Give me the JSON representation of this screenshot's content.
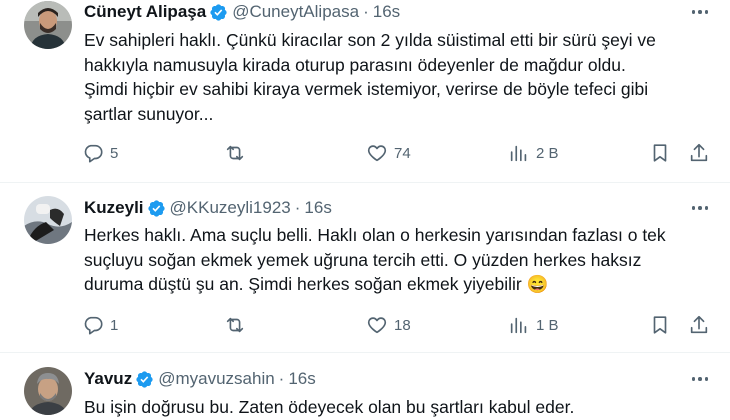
{
  "tweets": [
    {
      "name": "Cüneyt Alipaşa",
      "handle": "@CuneytAlipasa",
      "separator": "·",
      "time": "16s",
      "lines": [
        "Ev sahipleri haklı. Çünkü kiracılar son 2 yılda süistimal etti bir sürü şeyi ve",
        "hakkıyla namusuyla kirada oturup parasını ödeyenler de mağdur oldu.",
        "Şimdi hiçbir ev sahibi kiraya vermek istemiyor, verirse de böyle tefeci gibi",
        "şartlar sunuyor..."
      ],
      "replies": "5",
      "reposts": "",
      "likes": "74",
      "views": "2 B"
    },
    {
      "name": "Kuzeyli",
      "handle": "@KKuzeyli1923",
      "separator": "·",
      "time": "16s",
      "lines": [
        "Herkes haklı. Ama suçlu belli. Haklı olan o herkesin yarısından fazlası o tek",
        "suçluyu soğan ekmek yemek uğruna tercih etti. O yüzden herkes haksız",
        "duruma düştü şu an. Şimdi herkes soğan ekmek yiyebilir 😄"
      ],
      "replies": "1",
      "reposts": "",
      "likes": "18",
      "views": "1 B"
    },
    {
      "name": "Yavuz",
      "handle": "@myavuzsahin",
      "separator": "·",
      "time": "16s",
      "lines": [
        "Bu işin doğrusu bu. Zaten ödeyecek olan bu şartları kabul eder."
      ]
    }
  ],
  "colors": {
    "verified": "#1d9bf0",
    "secondary_text": "#536471",
    "primary_text": "#0f1419",
    "divider": "#eff3f4"
  },
  "icons": [
    "verified-badge-icon",
    "more-options-icon",
    "reply-icon",
    "repost-icon",
    "like-icon",
    "views-icon",
    "bookmark-icon",
    "share-icon"
  ]
}
